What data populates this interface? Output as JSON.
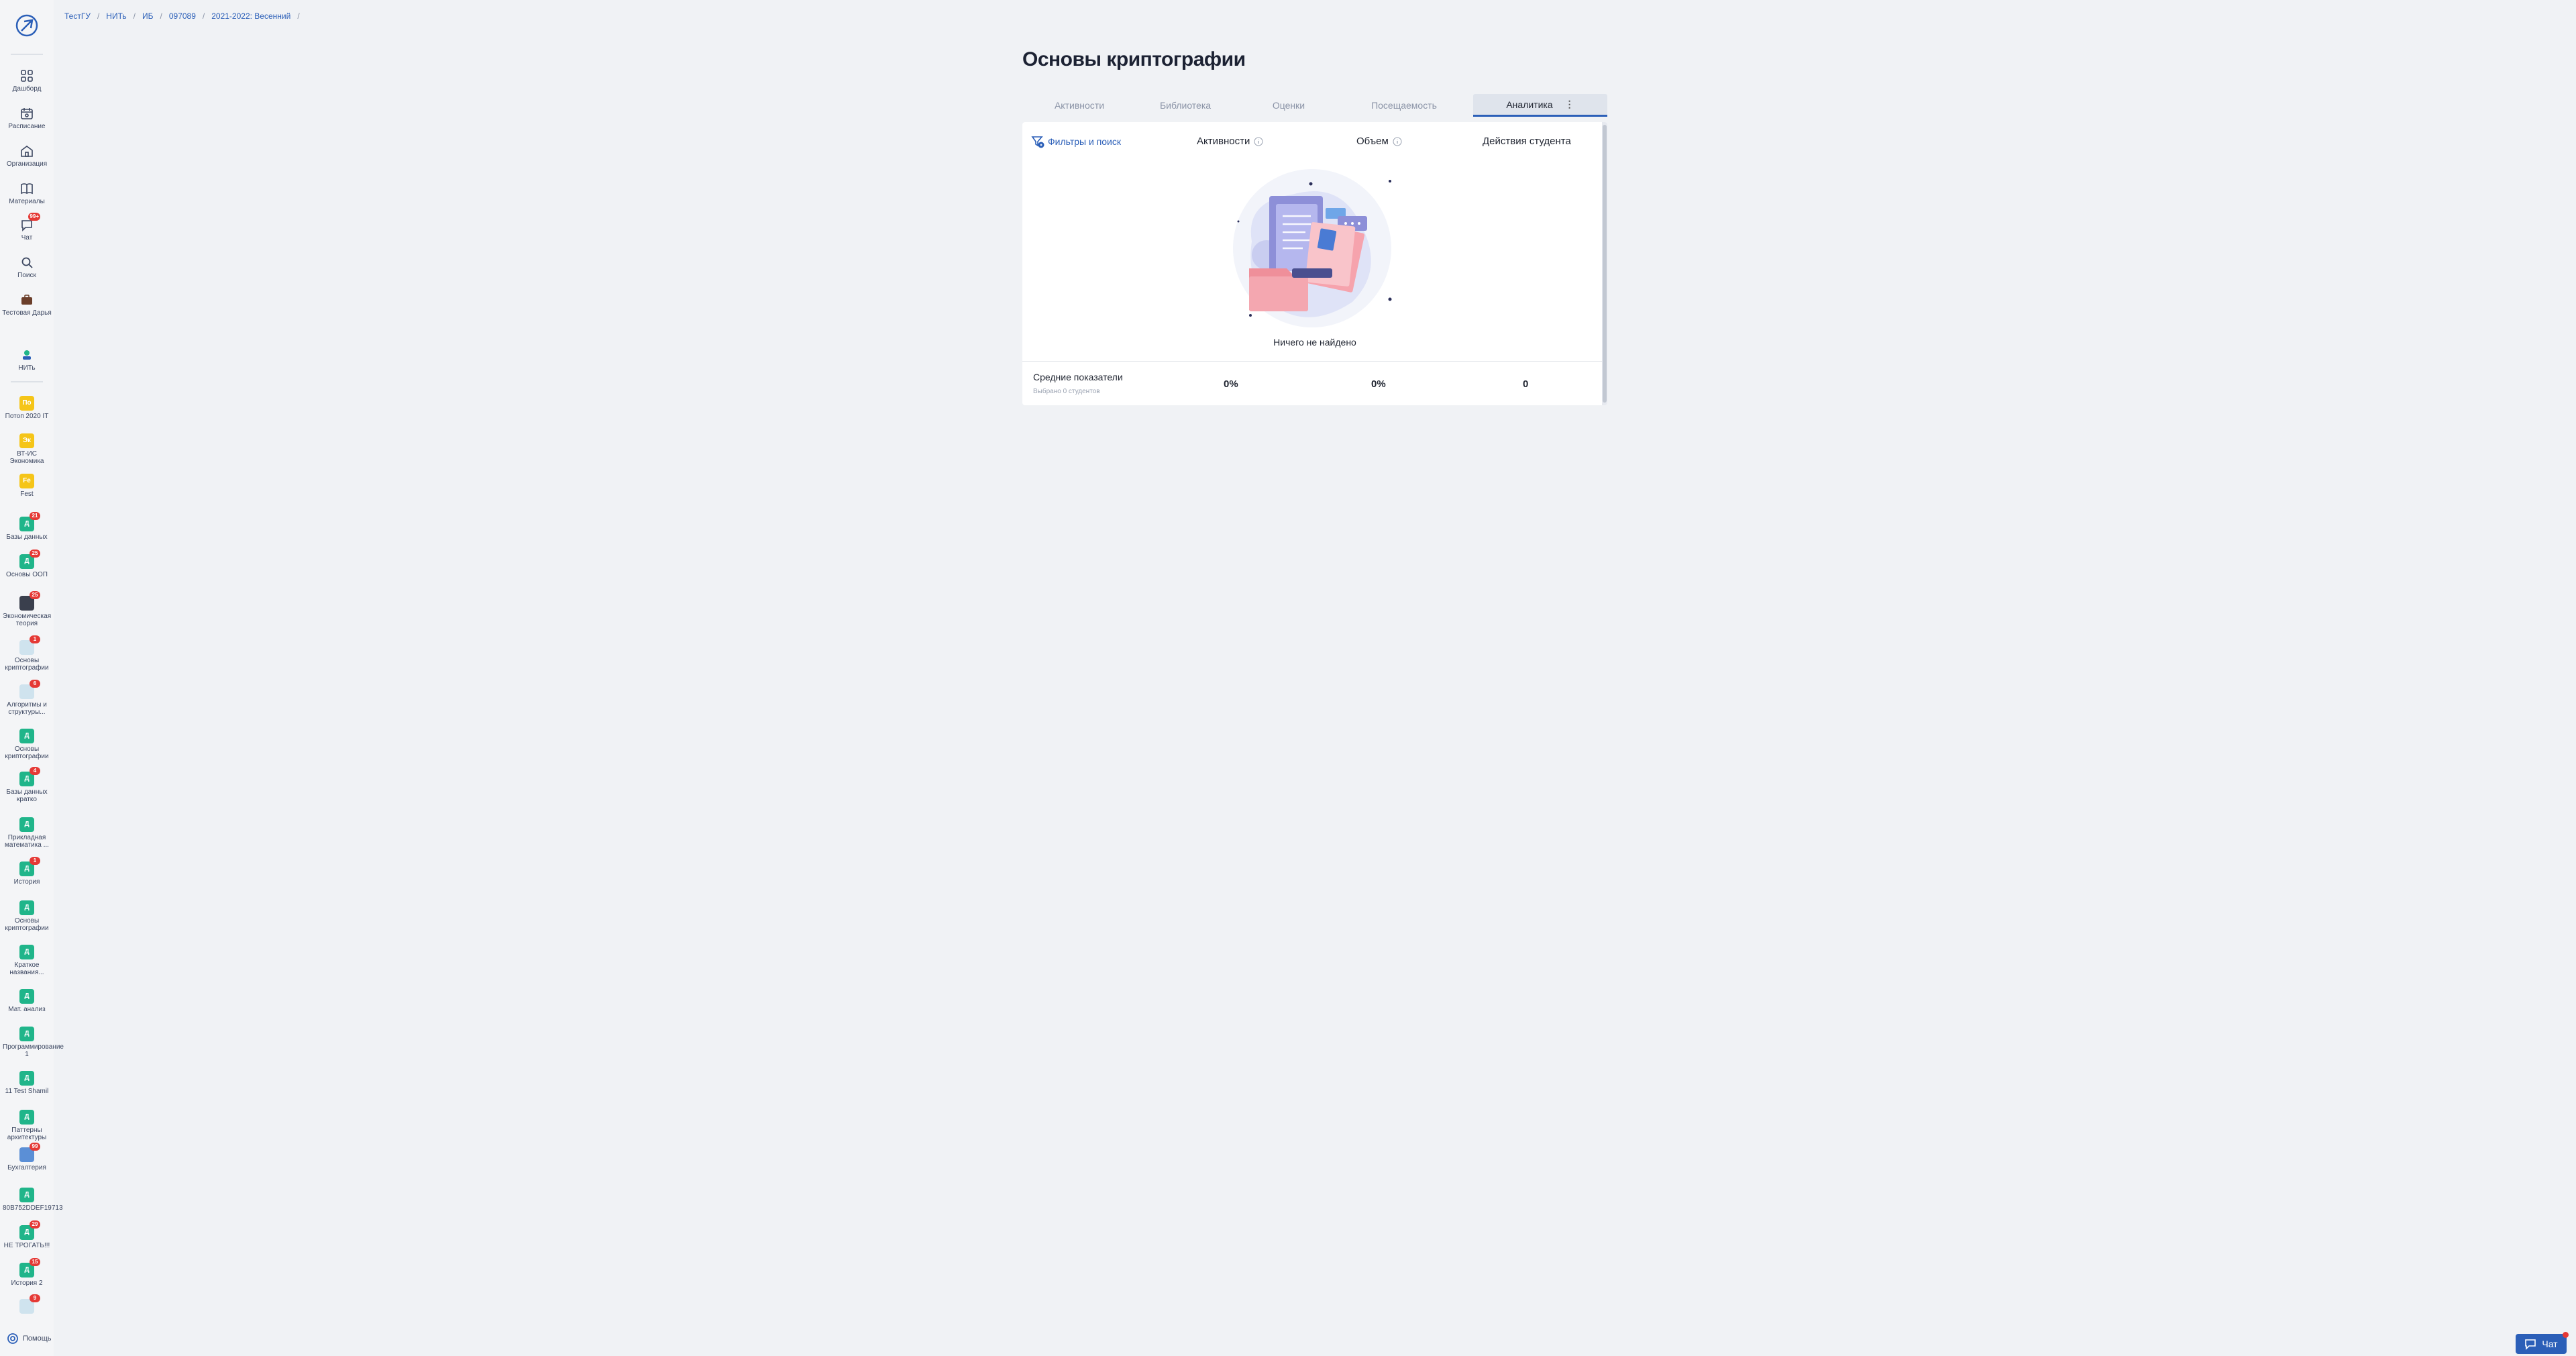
{
  "breadcrumb": [
    "ТестГУ",
    "НИТь",
    "ИБ",
    "097089",
    "2021-2022: Весенний"
  ],
  "sidebar": {
    "main_items": [
      {
        "label": "Дашборд",
        "icon": "dashboard-icon"
      },
      {
        "label": "Расписание",
        "icon": "calendar-icon"
      },
      {
        "label": "Организация",
        "icon": "building-icon"
      },
      {
        "label": "Материалы",
        "icon": "book-icon"
      },
      {
        "label": "Чат",
        "icon": "chat-icon",
        "badge": "99+"
      },
      {
        "label": "Поиск",
        "icon": "search-icon"
      },
      {
        "label": "Тестовая Дарья",
        "icon": "briefcase-icon"
      },
      {
        "label": "НИТь",
        "icon": "org-icon"
      }
    ],
    "courses": [
      {
        "label": "Потоп 2020 IT",
        "avatar": "По",
        "color": "yellow"
      },
      {
        "label": "ВТ-ИС Экономика",
        "avatar": "Эк",
        "color": "yellow"
      },
      {
        "label": "Fest",
        "avatar": "Fe",
        "color": "yellow"
      },
      {
        "label": "Базы данных",
        "avatar": "Д",
        "color": "teal",
        "badge": "21"
      },
      {
        "label": "Основы ООП",
        "avatar": "Д",
        "color": "teal",
        "badge": "25"
      },
      {
        "label": "Экономическая теория",
        "avatar": "",
        "color": "dark",
        "badge": "25"
      },
      {
        "label": "Основы криптографии",
        "avatar": "",
        "color": "pale",
        "badge": "1"
      },
      {
        "label": "Алгоритмы и структуры...",
        "avatar": "",
        "color": "pale",
        "badge": "6"
      },
      {
        "label": "Основы криптографии",
        "avatar": "Д",
        "color": "teal"
      },
      {
        "label": "Базы данных кратко",
        "avatar": "Д",
        "color": "teal",
        "badge": "4"
      },
      {
        "label": "Прикладная математика ...",
        "avatar": "Д",
        "color": "teal"
      },
      {
        "label": "История",
        "avatar": "Д",
        "color": "teal",
        "badge": "1"
      },
      {
        "label": "Основы криптографии",
        "avatar": "Д",
        "color": "teal"
      },
      {
        "label": "Краткое названия...",
        "avatar": "Д",
        "color": "teal"
      },
      {
        "label": "Мат. анализ",
        "avatar": "Д",
        "color": "teal"
      },
      {
        "label": "Программирование 1",
        "avatar": "Д",
        "color": "teal"
      },
      {
        "label": "11 Test Shamil",
        "avatar": "Д",
        "color": "teal"
      },
      {
        "label": "Паттерны архитектуры",
        "avatar": "Д",
        "color": "teal"
      },
      {
        "label": "Бухгалтерия",
        "avatar": "",
        "color": "blue",
        "badge": "99"
      },
      {
        "label": "80B752DDEF19713",
        "avatar": "Д",
        "color": "teal"
      },
      {
        "label": "НЕ ТРОГАТЬ!!!",
        "avatar": "Д",
        "color": "teal",
        "badge": "29"
      },
      {
        "label": "История 2",
        "avatar": "Д",
        "color": "teal",
        "badge": "15"
      },
      {
        "label": "",
        "avatar": "",
        "color": "pale",
        "badge": "9"
      }
    ],
    "help_label": "Помощь"
  },
  "page": {
    "title": "Основы криптографии"
  },
  "tabs": [
    {
      "label": "Активности",
      "active": false
    },
    {
      "label": "Библиотека",
      "active": false
    },
    {
      "label": "Оценки",
      "active": false
    },
    {
      "label": "Посещаемость",
      "active": false
    },
    {
      "label": "Аналитика",
      "active": true
    }
  ],
  "panel": {
    "filter_label": "Фильтры и поиск",
    "columns": {
      "activities": "Активности",
      "volume": "Объем",
      "student_actions": "Действия студента"
    },
    "empty_text": "Ничего не найдено",
    "averages": {
      "label": "Средние показатели",
      "subtitle": "Выбрано 0 студентов",
      "activities": "0%",
      "volume": "0%",
      "student_actions": "0"
    }
  },
  "chat_button": {
    "label": "Чат"
  },
  "colors": {
    "accent": "#2b5fb8",
    "badge": "#e53935",
    "teal": "#20b58a",
    "yellow": "#f5c518"
  }
}
